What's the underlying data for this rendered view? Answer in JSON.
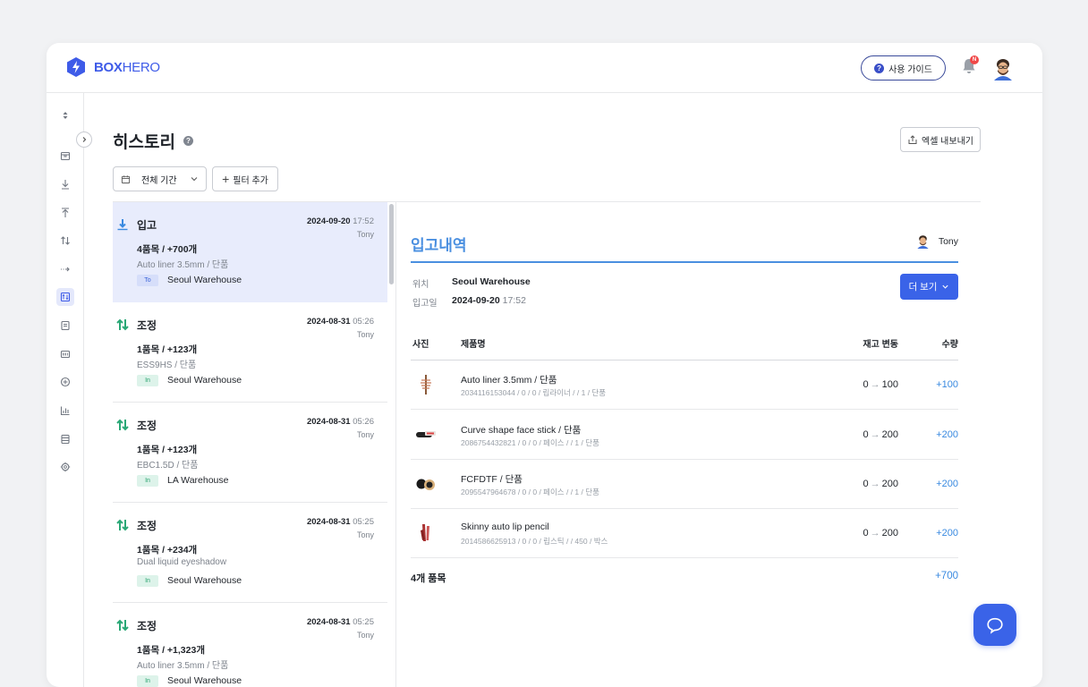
{
  "app": {
    "logo_bold": "BOX",
    "logo_thin": "HERO",
    "brand_color": "#3e5be8"
  },
  "topbar": {
    "guide_label": "사용 가이드",
    "notif_badge": "N"
  },
  "sidebar": {
    "items": [
      "selector-icon",
      "box-icon",
      "stock-in-icon",
      "stock-out-icon",
      "adjust-icon",
      "move-icon",
      "history-icon",
      "document-icon",
      "barcode-icon",
      "add-icon",
      "chart-icon",
      "list-icon",
      "settings-icon"
    ],
    "active": "history-icon"
  },
  "page": {
    "title": "히스토리",
    "help": "?",
    "export_label": "엑셀 내보내기"
  },
  "filters": {
    "period_label": "전체 기간",
    "add_filter_label": "필터 추가"
  },
  "history": [
    {
      "type": "입고",
      "date": "2024-09-20",
      "time": "17:52",
      "user": "Tony",
      "summary": "4품목 / +700개",
      "product": "Auto liner 3.5mm / 단품",
      "tag": "To",
      "warehouse": "Seoul Warehouse",
      "kind": "in",
      "selected": true
    },
    {
      "type": "조정",
      "date": "2024-08-31",
      "time": "05:26",
      "user": "Tony",
      "summary": "1품목 / +123개",
      "product": "ESS9HS / 단품",
      "tag": "In",
      "warehouse": "Seoul Warehouse",
      "kind": "adjust"
    },
    {
      "type": "조정",
      "date": "2024-08-31",
      "time": "05:26",
      "user": "Tony",
      "summary": "1품목 / +123개",
      "product": "EBC1.5D / 단품",
      "tag": "In",
      "warehouse": "LA Warehouse",
      "kind": "adjust"
    },
    {
      "type": "조정",
      "date": "2024-08-31",
      "time": "05:25",
      "user": "Tony",
      "summary": "1품목 / +234개",
      "product": "Dual liquid eyeshadow",
      "tag": "In",
      "warehouse": "Seoul Warehouse",
      "kind": "adjust"
    },
    {
      "type": "조정",
      "date": "2024-08-31",
      "time": "05:25",
      "user": "Tony",
      "summary": "1품목 / +1,323개",
      "product": "Auto liner 3.5mm / 단품",
      "tag": "In",
      "warehouse": "Seoul Warehouse",
      "kind": "adjust"
    }
  ],
  "detail": {
    "title": "입고내역",
    "user": "Tony",
    "location_label": "위치",
    "location_value": "Seoul Warehouse",
    "date_label": "입고일",
    "date_value": "2024-09-20",
    "time_value": "17:52",
    "more_label": "더 보기",
    "columns": {
      "photo": "사진",
      "name": "제품명",
      "change": "재고 변동",
      "qty": "수량"
    },
    "rows": [
      {
        "name": "Auto liner 3.5mm / 단품",
        "info": "2034116153044 / 0 / 0 / 립라이너 / / 1 / 단품",
        "from": "0",
        "to": "100",
        "qty": "+100"
      },
      {
        "name": "Curve shape face stick / 단품",
        "info": "2086754432821 / 0 / 0 / 페이스 / / 1 / 단품",
        "from": "0",
        "to": "200",
        "qty": "+200"
      },
      {
        "name": "FCFDTF / 단품",
        "info": "2095547964678 / 0 / 0 / 페이스 / / 1 / 단품",
        "from": "0",
        "to": "200",
        "qty": "+200"
      },
      {
        "name": "Skinny auto lip pencil",
        "info": "2014586625913 / 0 / 0 / 립스틱 / / 450 / 박스",
        "from": "0",
        "to": "200",
        "qty": "+200"
      }
    ],
    "total_label": "4개 품목",
    "total_qty": "+700"
  }
}
